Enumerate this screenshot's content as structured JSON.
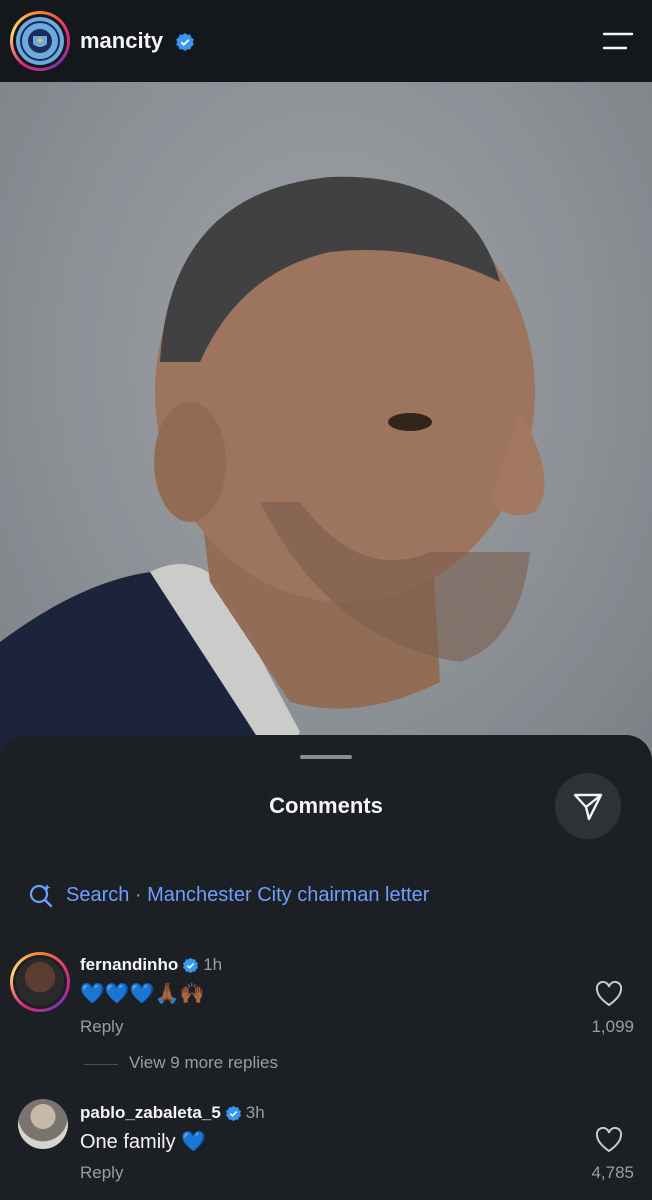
{
  "header": {
    "username": "mancity",
    "menu_icon": "menu-icon"
  },
  "sheet": {
    "title": "Comments",
    "search_label": "Search · Manchester City chairman letter"
  },
  "comments": [
    {
      "username": "fernandinho",
      "time": "1h",
      "text": "💙💙💙🙏🏾🙌🏾",
      "reply_label": "Reply",
      "likes": "1,099",
      "more_replies": "View 9 more replies"
    },
    {
      "username": "pablo_zabaleta_5",
      "time": "3h",
      "text": "One family 💙",
      "reply_label": "Reply",
      "likes": "4,785"
    }
  ],
  "colors": {
    "accent_link": "#6e9fff",
    "verified": "#3897f0",
    "sheet_bg": "#1c1f24"
  }
}
